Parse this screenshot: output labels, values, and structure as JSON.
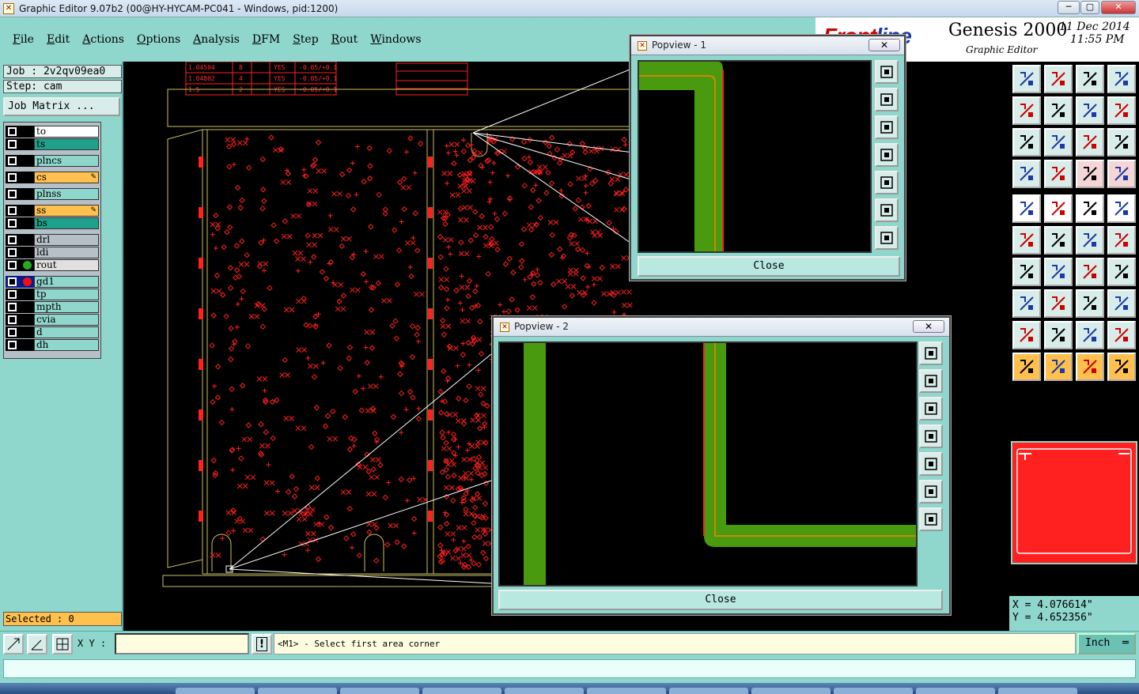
{
  "window": {
    "title": "Graphic Editor 9.07b2 (00@HY-HYCAM-PC041 - Windows, pid:1200)",
    "minimize": "─",
    "restore": "▢",
    "close": "✕"
  },
  "menu": [
    "File",
    "Edit",
    "Actions",
    "Options",
    "Analysis",
    "DFM",
    "Step",
    "Rout",
    "Windows"
  ],
  "branding": {
    "logo_a": "Front",
    "logo_b": "line",
    "product": "Genesis 2000",
    "subtitle": "Graphic Editor",
    "date": "11 Dec 2014",
    "time": "11:55 PM"
  },
  "job": {
    "job_label": "Job : 2v2qv09ea0",
    "step_label": "Step: cam",
    "matrix_button": "Job Matrix ..."
  },
  "layers": [
    {
      "name": "to",
      "color": "#ffffff"
    },
    {
      "name": "ts",
      "color": "#1fa08a"
    },
    {
      "name": "plncs",
      "color": "#8fd6cc"
    },
    {
      "name": "cs",
      "color": "#ffc04d",
      "pen": true
    },
    {
      "name": "plnss",
      "color": "#8fd6cc"
    },
    {
      "name": "ss",
      "color": "#ffc04d",
      "pen": true
    },
    {
      "name": "bs",
      "color": "#1fa08a"
    },
    {
      "name": "drl",
      "color": "#b5c0c8"
    },
    {
      "name": "ldi",
      "color": "#b5c0c8"
    },
    {
      "name": "rout",
      "color": "#e0e0e0",
      "dot": "#22aa22"
    },
    {
      "name": "gd1",
      "color": "#8fd6cc",
      "dot": "#ee1111",
      "active": true
    },
    {
      "name": "tp",
      "color": "#8fd6cc"
    },
    {
      "name": "mpth",
      "color": "#8fd6cc"
    },
    {
      "name": "cvia",
      "color": "#8fd6cc"
    },
    {
      "name": "d",
      "color": "#8fd6cc"
    },
    {
      "name": "dh",
      "color": "#8fd6cc"
    }
  ],
  "selected": "Selected : 0",
  "drawing_table": {
    "rows": [
      [
        "1.04504",
        "8",
        "YES",
        "-0.05/+0.1"
      ],
      [
        "1.04802",
        "4",
        "YES",
        "-0.05/+0.1"
      ],
      [
        "1.5",
        "2",
        "YES",
        "-0.05/+0.1"
      ]
    ]
  },
  "popview1": {
    "title": "Popview - 1",
    "close_label": "Close",
    "x_label": "✕"
  },
  "popview2": {
    "title": "Popview - 2",
    "close_label": "Close",
    "x_label": "✕"
  },
  "coords": {
    "x": "X = 4.076614\"",
    "y": "Y = 4.652356\""
  },
  "bottom": {
    "xy_label": "X Y :",
    "xy_value": "",
    "prompt": "<M1> - Select first area corner",
    "units": "Inch",
    "units_arrow": "═"
  },
  "colors": {
    "panel": "#8fd6cc",
    "copper": "#4a9a10",
    "pad": "#ff1a1a",
    "outline": "#c8c060"
  }
}
